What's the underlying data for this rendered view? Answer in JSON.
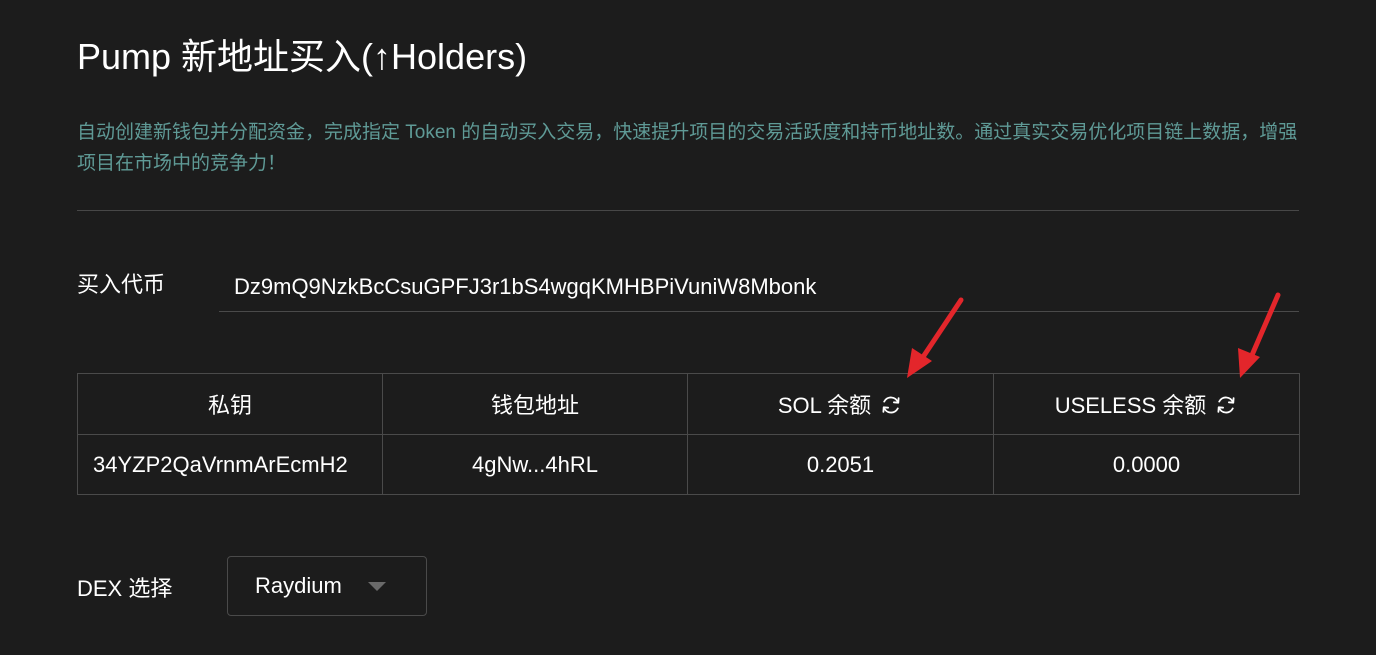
{
  "page": {
    "title": "Pump 新地址买入(↑Holders)",
    "description": "自动创建新钱包并分配资金，完成指定 Token 的自动买入交易，快速提升项目的交易活跃度和持币地址数。通过真实交易优化项目链上数据，增强项目在市场中的竞争力！"
  },
  "token": {
    "label": "买入代币",
    "value": "Dz9mQ9NzkBcCsuGPFJ3r1bS4wgqKMHBPiVuniW8Mbonk"
  },
  "table": {
    "headers": {
      "private_key": "私钥",
      "wallet_address": "钱包地址",
      "sol_balance": "SOL 余额",
      "useless_balance": "USELESS 余额"
    },
    "rows": [
      {
        "private_key": "34YZP2QaVrnmArEcmH2",
        "wallet_address": "4gNw...4hRL",
        "sol_balance": "0.2051",
        "useless_balance": "0.0000"
      }
    ]
  },
  "dex": {
    "label": "DEX 选择",
    "selected": "Raydium"
  },
  "icons": {
    "refresh": "refresh-icon",
    "dropdown": "caret-down-icon",
    "annotation": "red-arrow-annotation"
  },
  "colors": {
    "background": "#1c1c1c",
    "description_text": "#5f9a96",
    "border": "#4a4a4a",
    "annotation_red": "#e3262b"
  }
}
